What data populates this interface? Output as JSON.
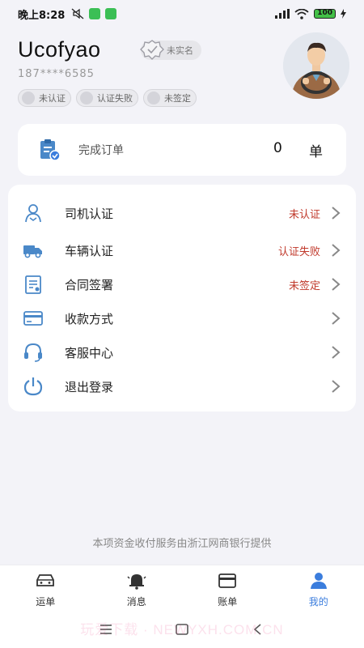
{
  "status_bar": {
    "time": "晚上8:28",
    "battery": "100"
  },
  "profile": {
    "username": "Ucofyao",
    "realname_badge": "未实名",
    "phone": "187****6585",
    "tags": [
      "未认证",
      "认证失败",
      "未签定"
    ]
  },
  "orders": {
    "label": "完成订单",
    "count": "0",
    "unit": "单"
  },
  "menu": [
    {
      "label": "司机认证",
      "status": "未认证",
      "icon": "driver-icon"
    },
    {
      "label": "车辆认证",
      "status": "认证失败",
      "icon": "truck-icon"
    },
    {
      "label": "合同签署",
      "status": "未签定",
      "icon": "contract-icon"
    },
    {
      "label": "收款方式",
      "status": "",
      "icon": "card-icon"
    },
    {
      "label": "客服中心",
      "status": "",
      "icon": "headset-icon"
    },
    {
      "label": "退出登录",
      "status": "",
      "icon": "power-icon"
    }
  ],
  "footer_note": "本项资金收付服务由浙江网商银行提供",
  "tabs": [
    {
      "label": "运单",
      "icon": "car-icon"
    },
    {
      "label": "消息",
      "icon": "bell-icon"
    },
    {
      "label": "账单",
      "icon": "wallet-icon"
    },
    {
      "label": "我的",
      "icon": "person-icon"
    }
  ],
  "active_tab": "我的",
  "watermark": "玩爱下载 · NEWYXH.COM.CN",
  "colors": {
    "accent": "#3b7ddd",
    "status_red": "#c0392b",
    "icon_blue": "#4a88c8",
    "background": "#f3f3f8"
  }
}
